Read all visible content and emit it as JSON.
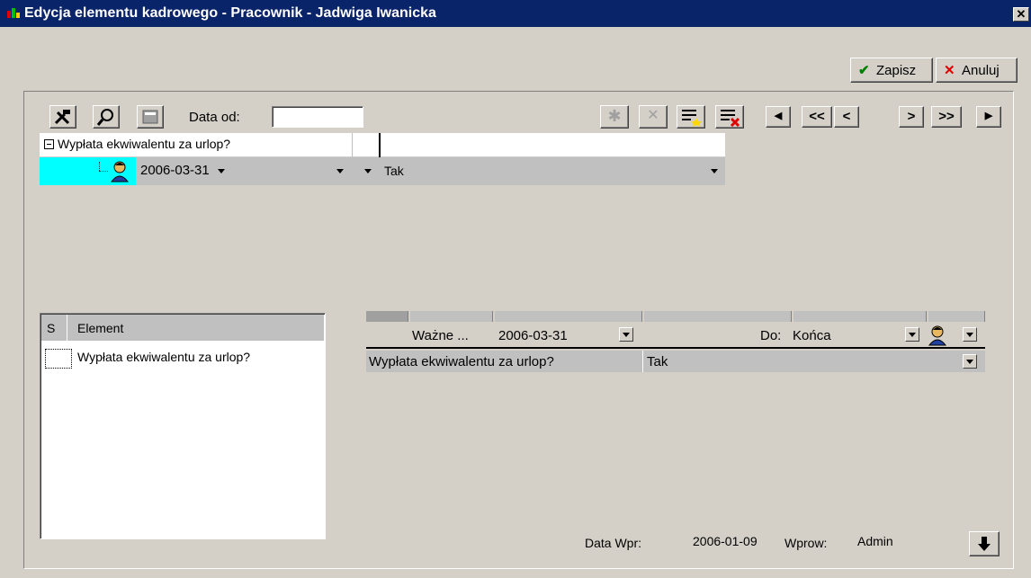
{
  "window": {
    "title": "Edycja elementu kadrowego - Pracownik - Jadwiga Iwanicka",
    "close_glyph": "✕"
  },
  "actions": {
    "save_label": "Zapisz",
    "cancel_label": "Anuluj"
  },
  "toolbar": {
    "date_from_label": "Data od:",
    "date_from_value": "",
    "nav": [
      "◀",
      "<<",
      "<",
      ">",
      ">>",
      "▶"
    ]
  },
  "tree": {
    "root_label": "Wypłata ekwiwalentu za urlop?",
    "row": {
      "date": "2006-03-31",
      "value": "Tak"
    }
  },
  "element_list": {
    "col_s": "S",
    "col_element": "Element",
    "items": [
      {
        "label": "Wypłata ekwiwalentu za urlop?"
      }
    ]
  },
  "detail": {
    "valid_label": "Ważne ...",
    "valid_date": "2006-03-31",
    "to_label": "Do:",
    "to_value": "Końca",
    "row_label": "Wypłata ekwiwalentu za urlop?",
    "row_value": "Tak"
  },
  "footer": {
    "entry_date_label": "Data Wpr:",
    "entry_date_value": "2006-01-09",
    "entered_by_label": "Wprow:",
    "entered_by_value": "Admin"
  },
  "colors": {
    "title_bar": "#0a246a",
    "window_bg": "#d4d0c8",
    "selection_cyan": "#00ffff",
    "save_check": "#008000",
    "cancel_x": "#e00000"
  }
}
